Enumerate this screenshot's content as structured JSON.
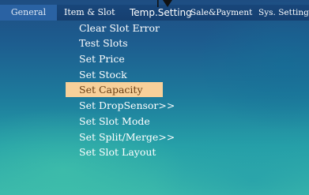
{
  "menubar": {
    "tabs": [
      {
        "label": "General",
        "active": true
      },
      {
        "label": "Item & Slot"
      },
      {
        "label": "Temp.Setting"
      },
      {
        "label": "Sale&Payment"
      },
      {
        "label": "Sys. Setting"
      }
    ]
  },
  "submenu": {
    "items": [
      {
        "label": "Clear Slot Error"
      },
      {
        "label": "Test Slots"
      },
      {
        "label": "Set Price"
      },
      {
        "label": "Set Stock"
      },
      {
        "label": "Set Capacity",
        "selected": true
      },
      {
        "label": "Set DropSensor>>"
      },
      {
        "label": "Set Slot Mode"
      },
      {
        "label": "Set Split/Merge>>"
      },
      {
        "label": "Set Slot Layout"
      }
    ]
  },
  "colors": {
    "menubar_bg": "#163f70",
    "active_tab_bg": "#2a62a3",
    "selection_bg": "#f7d09a",
    "selection_text": "#6a3d12"
  },
  "icons": {
    "pointer": "pointer-arrow-icon"
  }
}
